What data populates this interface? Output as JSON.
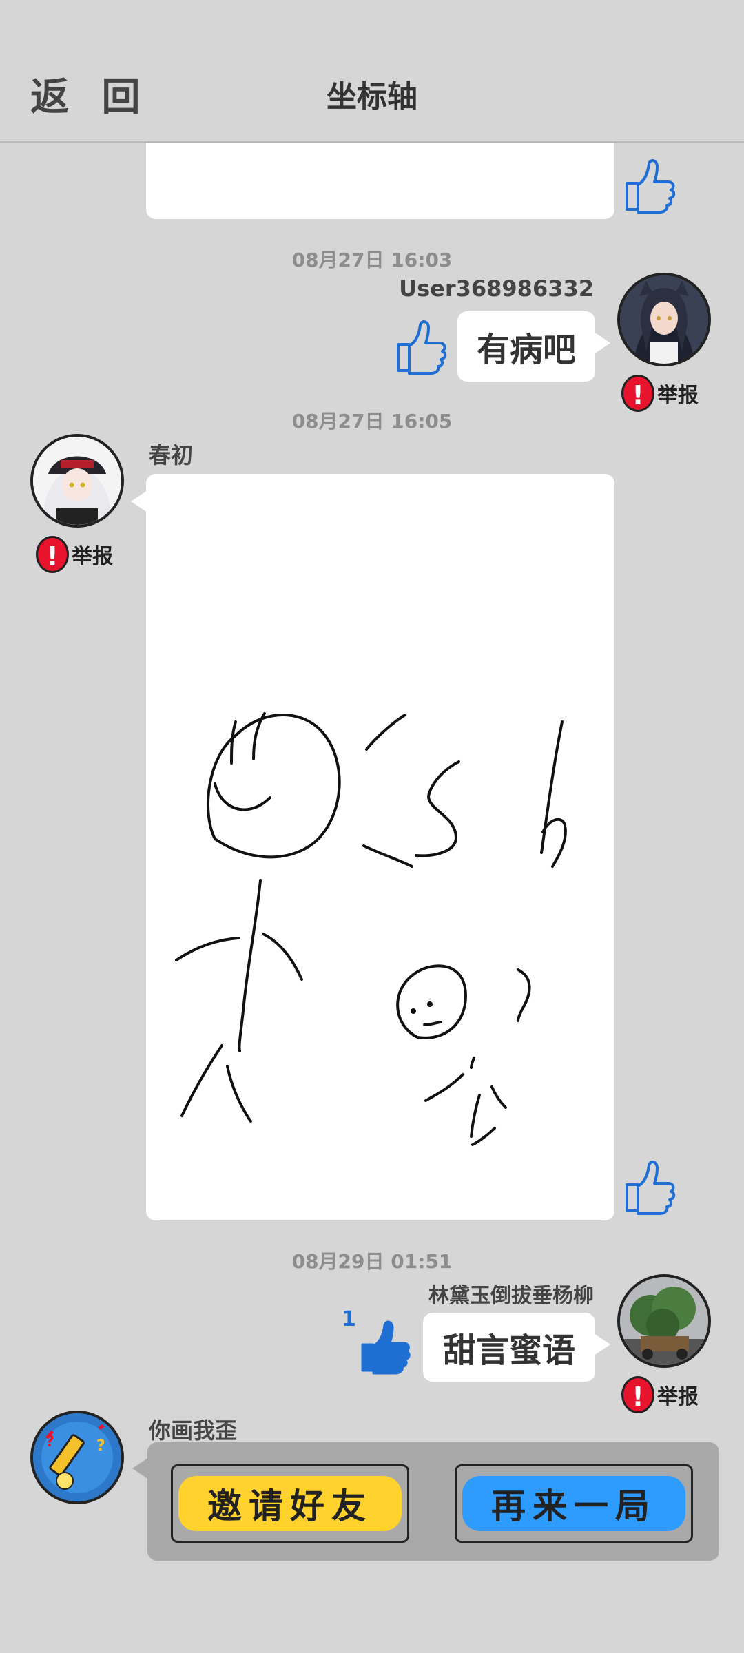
{
  "header": {
    "back_label": "返 回",
    "title": "坐标轴"
  },
  "messages": [
    {
      "timestamp": "08月27日  16:03",
      "username": "User368986332",
      "text": "有病吧",
      "report_label": "举报"
    },
    {
      "timestamp": "08月27日  16:05",
      "username": "春初",
      "report_label": "举报"
    },
    {
      "timestamp": "08月29日  01:51",
      "username": "林黛玉倒拔垂杨柳",
      "text": "甜言蜜语",
      "report_label": "举报",
      "like_count": "1"
    }
  ],
  "game": {
    "username": "你画我歪",
    "invite_label": "邀请好友",
    "again_label": "再来一局"
  },
  "colors": {
    "background": "#d6d6d6",
    "like_blue": "#1f6ed4",
    "report_red": "#e8132c",
    "invite_yellow": "#ffd22e",
    "again_blue": "#2e9bff"
  },
  "icons": [
    "back-icon",
    "thumbs-up-icon",
    "report-exclamation-icon",
    "pencil-avatar-icon"
  ]
}
